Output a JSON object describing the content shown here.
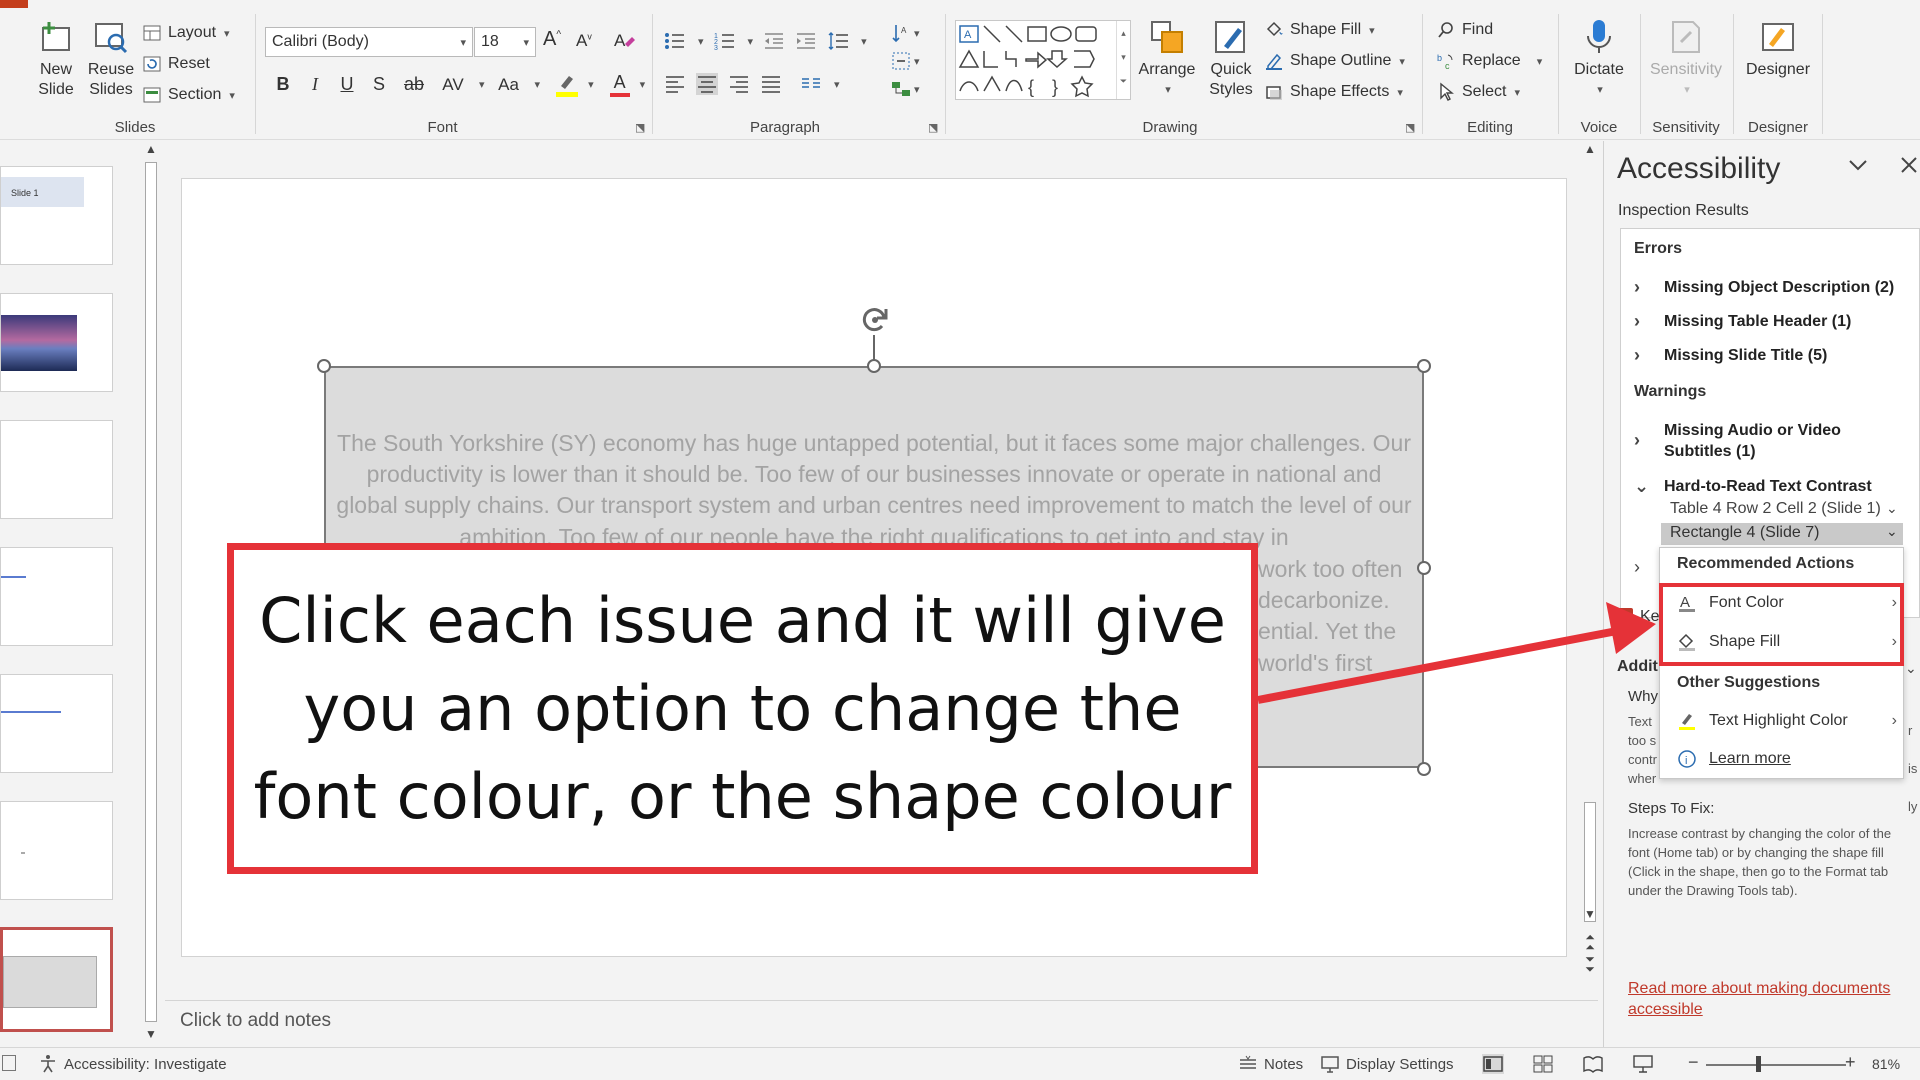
{
  "ribbon": {
    "slides_group": {
      "label": "Slides",
      "new_slide": "New Slide",
      "reuse_slides": "Reuse Slides",
      "layout": "Layout",
      "reset": "Reset",
      "section": "Section"
    },
    "font_group": {
      "label": "Font",
      "font_name": "Calibri (Body)",
      "font_size": "18",
      "bold": "B",
      "italic": "I",
      "underline": "U",
      "shadow": "S",
      "strike": "ab",
      "spacing": "AV",
      "case": "Aa",
      "font_color": "A",
      "grow": "A",
      "shrink": "A"
    },
    "paragraph_group": {
      "label": "Paragraph"
    },
    "drawing_group": {
      "label": "Drawing",
      "arrange": "Arrange",
      "quick_styles": "Quick Styles",
      "shape_fill": "Shape Fill",
      "shape_outline": "Shape Outline",
      "shape_effects": "Shape Effects"
    },
    "editing_group": {
      "label": "Editing",
      "find": "Find",
      "replace": "Replace",
      "select": "Select"
    },
    "voice_group": {
      "label": "Voice",
      "dictate": "Dictate"
    },
    "sensitivity_group": {
      "label": "Sensitivity",
      "sensitivity": "Sensitivity"
    },
    "designer_group": {
      "label": "Designer",
      "designer": "Designer"
    }
  },
  "thumbnails": {
    "slide1_label": "Slide 1"
  },
  "slide": {
    "body_text": "The South Yorkshire (SY) economy has huge untapped potential, but it faces some major challenges. Our productivity is lower than it should be. Too few of our businesses innovate or operate in national and global supply chains. Our transport system and urban centres need improvement to match the level of our ambition. Too few of our people have the right qualifications to get into and stay in",
    "fragment_1": "work too often",
    "fragment_2": "decarbonize.",
    "fragment_3": "ential. Yet the",
    "fragment_4": "world's first"
  },
  "callout": {
    "text": "Click each issue and it will give you an option to change the font colour, or the shape colour"
  },
  "notes": {
    "placeholder": "Click to add notes"
  },
  "accessibility_pane": {
    "title": "Accessibility",
    "inspection_results": "Inspection Results",
    "errors_heading": "Errors",
    "errors": [
      "Missing Object Description (2)",
      "Missing Table Header (1)",
      "Missing Slide Title (5)"
    ],
    "warnings_heading": "Warnings",
    "warnings": [
      "Missing Audio or Video Subtitles (1)",
      "Hard-to-Read Text Contrast"
    ],
    "contrast_items": [
      "Table 4 Row 2 Cell 2 (Slide 1)",
      "Rectangle 4  (Slide 7)"
    ],
    "menu": {
      "recommended_heading": "Recommended Actions",
      "recommended": [
        "Font Color",
        "Shape Fill"
      ],
      "other_heading": "Other Suggestions",
      "other": [
        "Text Highlight Color",
        "Learn more"
      ]
    },
    "keep_label": "Ke",
    "additional_heading": "Addit",
    "why_label": "Why",
    "why_lines": [
      "Text",
      "too s",
      "contr",
      "wher"
    ],
    "why_right": [
      "r is",
      "ly"
    ],
    "steps_heading": "Steps To Fix:",
    "steps_text": "Increase contrast by changing the color of the font (Home tab) or by changing the shape fill (Click in the shape, then go to the Format tab under the Drawing Tools tab).",
    "read_more": "Read more about making documents accessible"
  },
  "status_bar": {
    "accessibility": "Accessibility: Investigate",
    "notes": "Notes",
    "display_settings": "Display Settings",
    "zoom": "81%"
  },
  "colors": {
    "highlight_red": "#e53238",
    "link_red": "#c0392b",
    "brand_orange": "#c43e1c"
  }
}
